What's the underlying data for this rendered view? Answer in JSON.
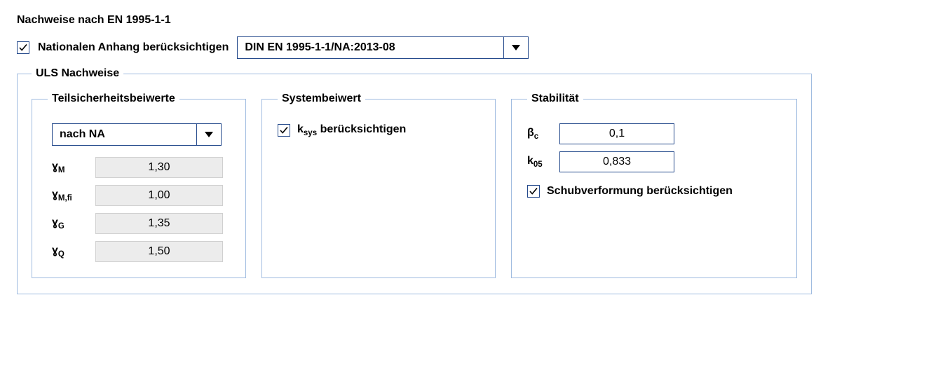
{
  "header": {
    "title": "Nachweise nach EN 1995-1-1",
    "national_annex_label": "Nationalen Anhang berücksichtigen",
    "national_annex_selected": "DIN EN 1995-1-1/NA:2013-08"
  },
  "uls": {
    "legend": "ULS Nachweise",
    "partial": {
      "legend": "Teilsicherheitsbeiwerte",
      "source_selected": "nach NA",
      "factors": {
        "gamma_M_label": "ɣ",
        "gamma_M_sub": "M",
        "gamma_M_value": "1,30",
        "gamma_Mfi_label": "ɣ",
        "gamma_Mfi_sub": "M,fi",
        "gamma_Mfi_value": "1,00",
        "gamma_G_label": "ɣ",
        "gamma_G_sub": "G",
        "gamma_G_value": "1,35",
        "gamma_Q_label": "ɣ",
        "gamma_Q_sub": "Q",
        "gamma_Q_value": "1,50"
      }
    },
    "system": {
      "legend": "Systembeiwert",
      "ksys_prefix": "k",
      "ksys_sub": "sys",
      "ksys_suffix": " berücksichtigen"
    },
    "stability": {
      "legend": "Stabilität",
      "beta_c_label": "β",
      "beta_c_sub": "c",
      "beta_c_value": "0,1",
      "k05_label": "k",
      "k05_sub": "05",
      "k05_value": "0,833",
      "shear_label": "Schubverformung berücksichtigen"
    }
  }
}
